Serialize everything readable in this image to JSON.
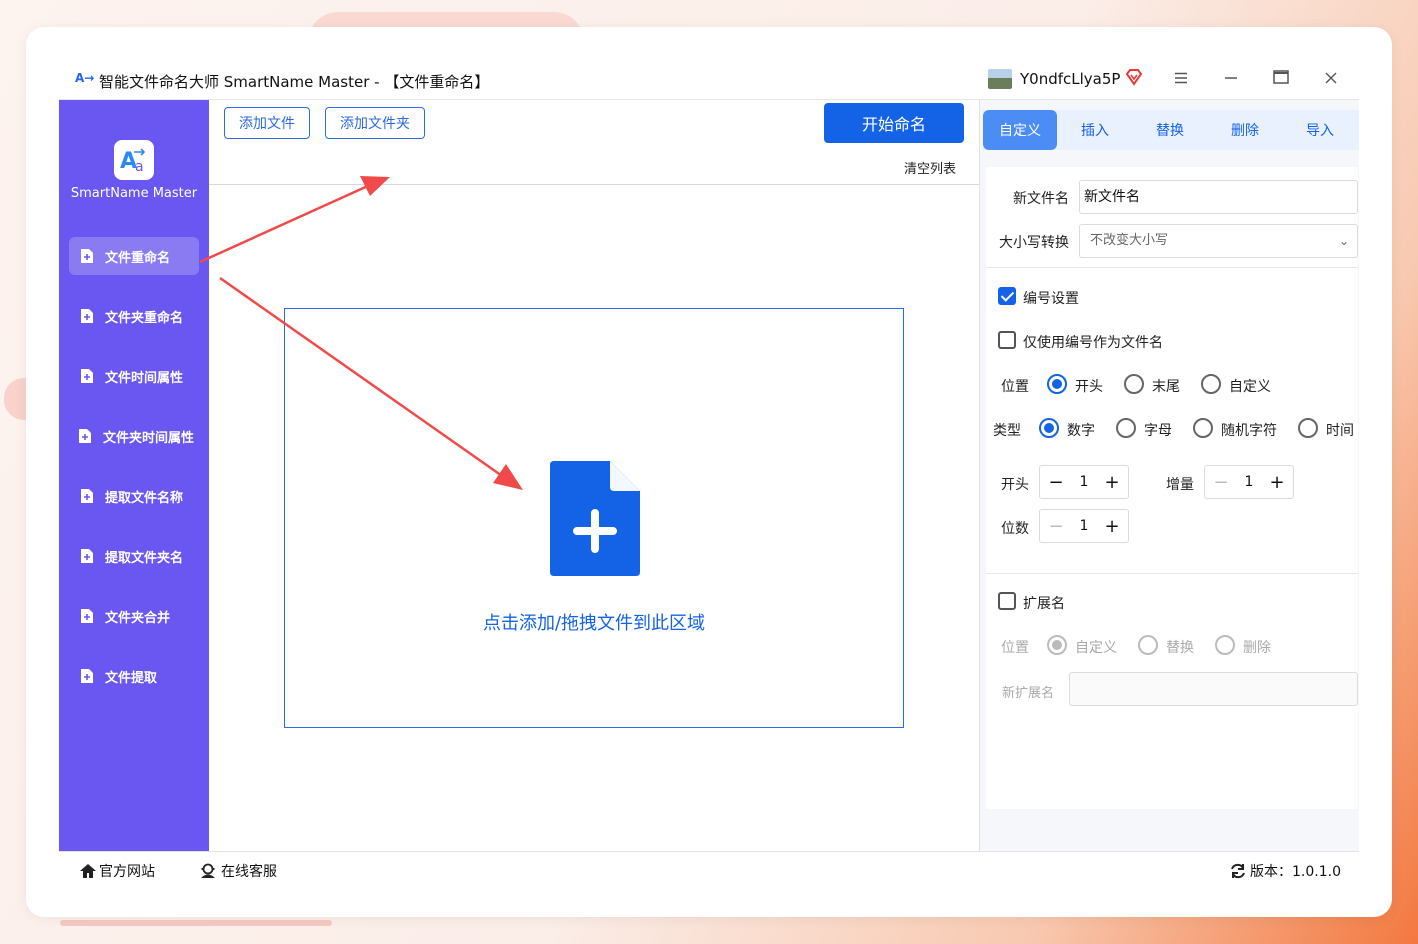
{
  "window": {
    "app_logo": "A→",
    "title": "智能文件命名大师 SmartName Master - 【文件重命名】",
    "user_name": "Y0ndfcLlya5P",
    "menu_icon": "menu-icon",
    "minimize_icon": "minimize-icon",
    "maximize_icon": "maximize-icon",
    "close_icon": "close-icon"
  },
  "sidebar": {
    "app_name": "SmartName Master",
    "items": [
      {
        "label": "文件重命名",
        "active": true
      },
      {
        "label": "文件夹重命名",
        "active": false
      },
      {
        "label": "文件时间属性",
        "active": false
      },
      {
        "label": "文件夹时间属性",
        "active": false
      },
      {
        "label": "提取文件名称",
        "active": false
      },
      {
        "label": "提取文件夹名",
        "active": false
      },
      {
        "label": "文件夹合并",
        "active": false
      },
      {
        "label": "文件提取",
        "active": false
      }
    ]
  },
  "toolbar": {
    "add_file": "添加文件",
    "add_folder": "添加文件夹",
    "start": "开始命名",
    "clear_list": "清空列表"
  },
  "dropzone": {
    "text": "点击添加/拖拽文件到此区域"
  },
  "tabs": [
    {
      "label": "自定义",
      "active": true
    },
    {
      "label": "插入",
      "active": false
    },
    {
      "label": "替换",
      "active": false
    },
    {
      "label": "删除",
      "active": false
    },
    {
      "label": "导入",
      "active": false
    }
  ],
  "settings": {
    "new_name_label": "新文件名",
    "new_name_value": "新文件名",
    "case_label": "大小写转换",
    "case_value": "不改变大小写",
    "numbering_label": "编号设置",
    "numbering_checked": true,
    "only_number_label": "仅使用编号作为文件名",
    "only_number_checked": false,
    "position_label": "位置",
    "position_options": [
      "开头",
      "末尾",
      "自定义"
    ],
    "position_selected": "开头",
    "type_label": "类型",
    "type_options": [
      "数字",
      "字母",
      "随机字符",
      "时间"
    ],
    "type_selected": "数字",
    "start_label": "开头",
    "start_value": "1",
    "increment_label": "增量",
    "increment_value": "1",
    "digits_label": "位数",
    "digits_value": "1",
    "ext_label": "扩展名",
    "ext_checked": false,
    "ext_position_label": "位置",
    "ext_position_options": [
      "自定义",
      "替换",
      "删除"
    ],
    "ext_position_selected": "自定义",
    "new_ext_label": "新扩展名",
    "new_ext_value": ""
  },
  "statusbar": {
    "website": "官方网站",
    "support": "在线客服",
    "version": "版本：1.0.1.0"
  },
  "colors": {
    "sidebar_bg": "#6a56f0",
    "accent": "#1463e6",
    "annotation_arrow": "#f04a4a"
  }
}
